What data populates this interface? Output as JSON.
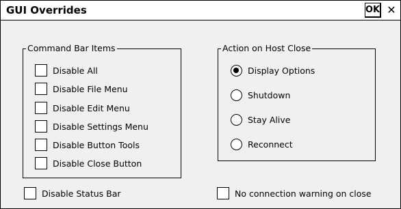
{
  "window": {
    "title": "GUI Overrides",
    "ok_label": "OK",
    "close_glyph": "✕"
  },
  "command_bar": {
    "title": "Command Bar Items",
    "items": [
      {
        "label": "Disable All",
        "checked": false
      },
      {
        "label": "Disable File Menu",
        "checked": false
      },
      {
        "label": "Disable Edit Menu",
        "checked": false
      },
      {
        "label": "Disable Settings Menu",
        "checked": false
      },
      {
        "label": "Disable Button Tools",
        "checked": false
      },
      {
        "label": "Disable Close Button",
        "checked": false
      }
    ]
  },
  "host_close": {
    "title": "Action on Host Close",
    "options": [
      {
        "label": "Display Options",
        "selected": true
      },
      {
        "label": "Shutdown",
        "selected": false
      },
      {
        "label": "Stay Alive",
        "selected": false
      },
      {
        "label": "Reconnect",
        "selected": false
      }
    ]
  },
  "bottom": {
    "status_bar_label": "Disable Status Bar",
    "status_bar_checked": false,
    "warning_label": "No connection warning on close",
    "warning_checked": false
  }
}
